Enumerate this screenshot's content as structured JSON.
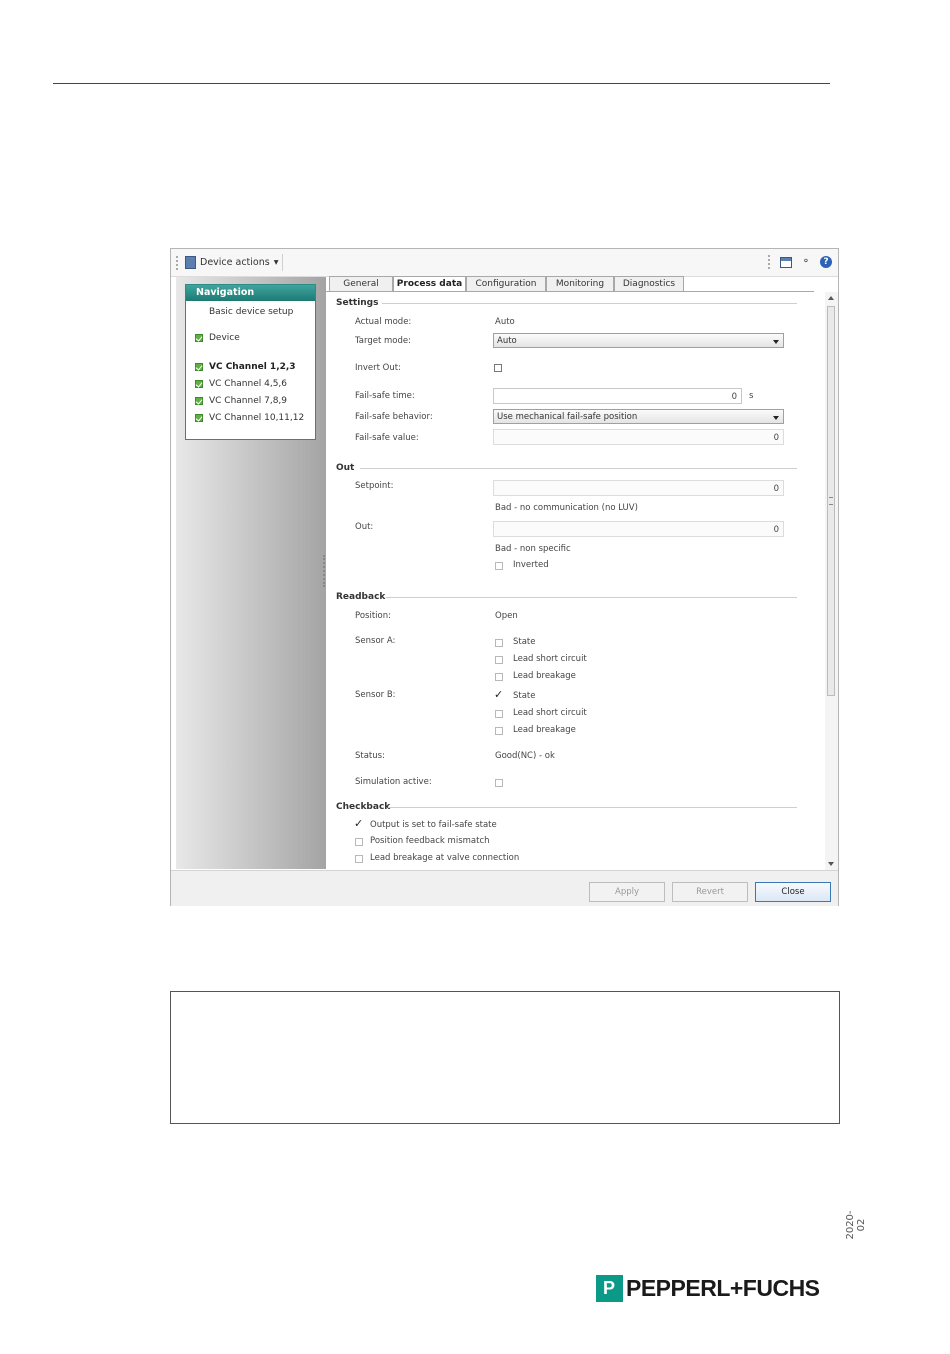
{
  "toolbar": {
    "device_actions": "Device actions",
    "device_actions_arrow": "▾"
  },
  "navigation": {
    "title": "Navigation",
    "items": [
      {
        "label": "Basic device setup",
        "checked": false,
        "bold": false
      },
      {
        "label": "Device",
        "checked": true,
        "bold": false
      },
      {
        "label": "VC Channel 1,2,3",
        "checked": true,
        "bold": true
      },
      {
        "label": "VC Channel 4,5,6",
        "checked": true,
        "bold": false
      },
      {
        "label": "VC Channel 7,8,9",
        "checked": true,
        "bold": false
      },
      {
        "label": "VC Channel 10,11,12",
        "checked": true,
        "bold": false
      }
    ]
  },
  "tabs": [
    {
      "label": "General",
      "active": false
    },
    {
      "label": "Process data",
      "active": true
    },
    {
      "label": "Configuration",
      "active": false
    },
    {
      "label": "Monitoring",
      "active": false
    },
    {
      "label": "Diagnostics",
      "active": false
    }
  ],
  "settings": {
    "heading": "Settings",
    "actual_mode_label": "Actual mode:",
    "actual_mode_value": "Auto",
    "target_mode_label": "Target mode:",
    "target_mode_value": "Auto",
    "invert_out_label": "Invert Out:",
    "invert_out_checked": false,
    "failsafe_time_label": "Fail-safe time:",
    "failsafe_time_value": "0",
    "failsafe_time_unit": "s",
    "failsafe_behavior_label": "Fail-safe behavior:",
    "failsafe_behavior_value": "Use mechanical fail-safe position",
    "failsafe_value_label": "Fail-safe value:",
    "failsafe_value_value": "0"
  },
  "out": {
    "heading": "Out",
    "setpoint_label": "Setpoint:",
    "setpoint_value": "0",
    "setpoint_status": "Bad - no communication (no LUV)",
    "out_label": "Out:",
    "out_value": "0",
    "out_status": "Bad - non specific",
    "inverted_label": "Inverted",
    "inverted_checked": false
  },
  "readback": {
    "heading": "Readback",
    "position_label": "Position:",
    "position_value": "Open",
    "sensor_a_label": "Sensor A:",
    "sensor_a_options": [
      {
        "label": "State",
        "checked": false
      },
      {
        "label": "Lead short circuit",
        "checked": false
      },
      {
        "label": "Lead breakage",
        "checked": false
      }
    ],
    "sensor_b_label": "Sensor B:",
    "sensor_b_options": [
      {
        "label": "State",
        "checked": true
      },
      {
        "label": "Lead short circuit",
        "checked": false
      },
      {
        "label": "Lead breakage",
        "checked": false
      }
    ],
    "status_label": "Status:",
    "status_value": "Good(NC) - ok",
    "simulation_label": "Simulation active:",
    "simulation_checked": false
  },
  "checkback": {
    "heading": "Checkback",
    "options": [
      {
        "label": "Output is set to fail-safe state",
        "checked": true
      },
      {
        "label": "Position feedback mismatch",
        "checked": false
      },
      {
        "label": "Lead breakage at valve connection",
        "checked": false
      }
    ]
  },
  "footer": {
    "apply": "Apply",
    "revert": "Revert",
    "close": "Close"
  },
  "page": {
    "doc_date": "2020-02",
    "logo_text": "PEPPERL+FUCHS",
    "logo_mark": "P"
  },
  "colors": {
    "nav_header": "#1d7a73",
    "accent_blue": "#2b63b5",
    "logo_teal": "#0b9a88",
    "check_green": "#5fb142"
  }
}
